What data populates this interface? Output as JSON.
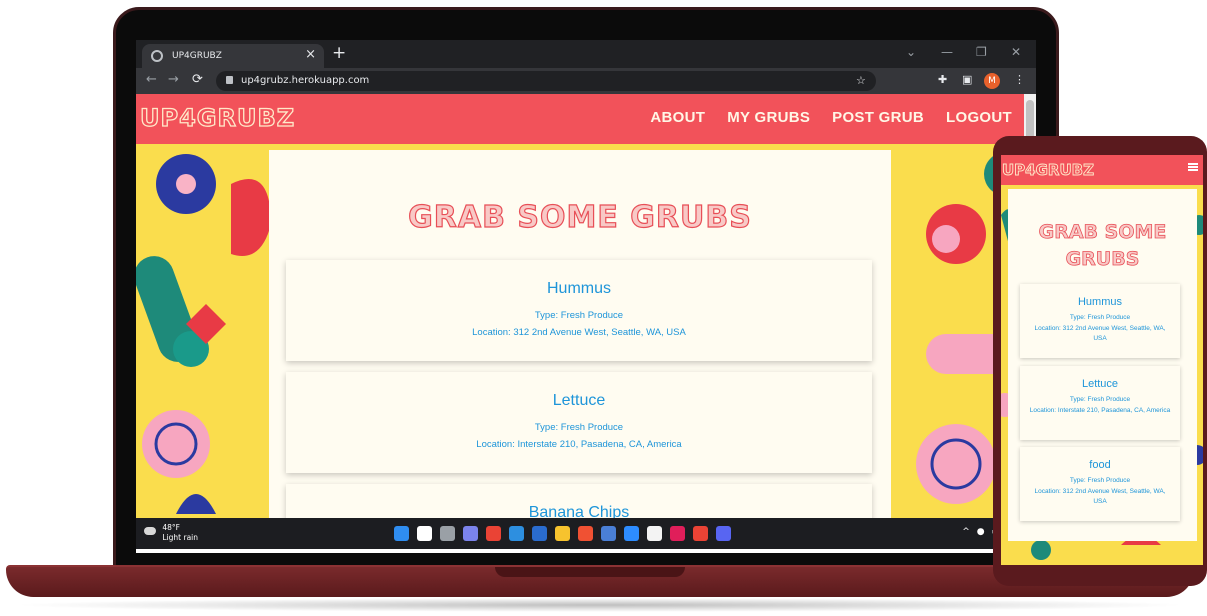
{
  "browser": {
    "tab_title": "UP4GRUBZ",
    "tab_close": "×",
    "new_tab": "+",
    "url": "up4grubz.herokuapp.com",
    "profile_initial": "M",
    "window_controls": [
      "⌄",
      "—",
      "❐",
      "✕"
    ]
  },
  "site": {
    "brand": "UP4GRUBZ",
    "nav": [
      "ABOUT",
      "MY GRUBS",
      "POST GRUB",
      "LOGOUT"
    ],
    "heading": "GRAB SOME GRUBS",
    "colors": {
      "navbar": "#f2525a",
      "pattern": "#fadd4d",
      "card_text": "#1e95d9",
      "panel": "#fffcf1"
    }
  },
  "laptop_cards": [
    {
      "name": "Hummus",
      "type": "Type: Fresh Produce",
      "location": "Location: 312 2nd Avenue West, Seattle, WA, USA"
    },
    {
      "name": "Lettuce",
      "type": "Type: Fresh Produce",
      "location": "Location: Interstate 210, Pasadena, CA, America"
    },
    {
      "name": "Banana Chips",
      "type": "",
      "location": ""
    }
  ],
  "phone": {
    "brand": "UP4GRUBZ",
    "heading": "GRAB SOME GRUBS",
    "cards": [
      {
        "name": "Hummus",
        "type": "Type: Fresh Produce",
        "location": "Location: 312 2nd Avenue West, Seattle, WA, USA"
      },
      {
        "name": "Lettuce",
        "type": "Type: Fresh Produce",
        "location": "Location: Interstate 210, Pasadena, CA, America"
      },
      {
        "name": "food",
        "type": "Type: Fresh Produce",
        "location": "Location: 312 2nd Avenue West, Seattle, WA, USA"
      }
    ]
  },
  "taskbar": {
    "temp": "48°F",
    "condition": "Light rain",
    "app_icons": [
      "windows-start-icon",
      "search-icon",
      "task-view-icon",
      "chat-icon",
      "chrome-icon",
      "vscode-icon",
      "outlook-icon",
      "file-explorer-icon",
      "git-icon",
      "terminal-icon",
      "zoom-icon",
      "calendar-icon",
      "slack-icon",
      "chrome-profile-icon",
      "discord-icon"
    ],
    "app_icon_colors": [
      "#2f8df0",
      "#ffffff",
      "#9aa0a6",
      "#7b83eb",
      "#ea4335",
      "#2d8fe0",
      "#2a6ccf",
      "#f7c32e",
      "#f05133",
      "#4a7fd6",
      "#2d8cff",
      "#f3f3f3",
      "#e01e5a",
      "#ea4335",
      "#5865f2"
    ]
  }
}
